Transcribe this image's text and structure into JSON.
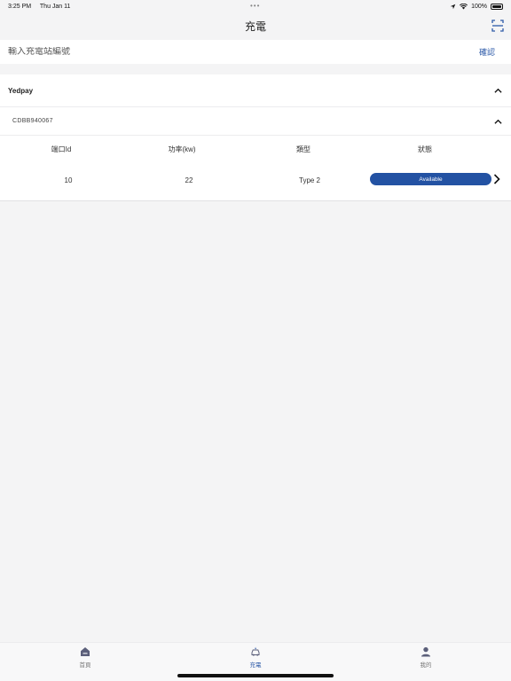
{
  "status_bar": {
    "time": "3:25 PM",
    "date": "Thu Jan 11",
    "battery": "100%"
  },
  "nav": {
    "title": "充電"
  },
  "search": {
    "placeholder": "輸入充電站編號",
    "value": "",
    "confirm_label": "確認"
  },
  "station": {
    "name": "Yedpay",
    "charger": {
      "id": "CDBB940067",
      "columns": [
        "端口Id",
        "功率(kw)",
        "類型",
        "狀態"
      ],
      "ports": [
        {
          "port_id": "10",
          "power": "22",
          "type": "Type 2",
          "status": "Available"
        }
      ]
    }
  },
  "tabs": [
    {
      "label": "首頁",
      "icon": "home-icon",
      "active": false
    },
    {
      "label": "充電",
      "icon": "ev-charging-icon",
      "active": true
    },
    {
      "label": "我的",
      "icon": "user-icon",
      "active": false
    }
  ],
  "colors": {
    "accent": "#2d5aa8",
    "status_available": "#2352a3",
    "background": "#f4f4f5"
  }
}
